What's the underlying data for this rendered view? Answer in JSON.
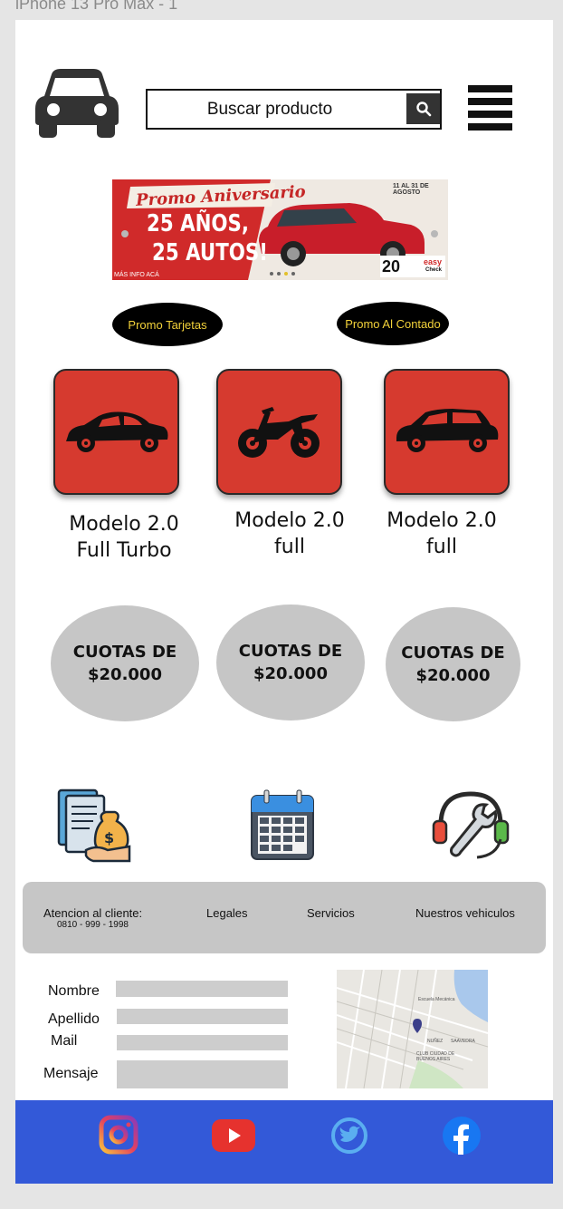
{
  "frame": {
    "title": "iPhone 13 Pro Max - 1"
  },
  "header": {
    "logo_icon": "car-icon",
    "search": {
      "placeholder": "Buscar producto",
      "icon": "search-icon"
    },
    "menu_icon": "hamburger-menu-icon"
  },
  "banner": {
    "headline": "Promo Aniversario",
    "line1": "25 AÑOS,",
    "line2": "25 AUTOS!",
    "dates": "11 AL 31 DE AGOSTO",
    "footer": "MÁS INFO ACÁ",
    "badge": "20",
    "brand": "easy",
    "brand_sub": "Check"
  },
  "promos": [
    {
      "label": "Promo Tarjetas"
    },
    {
      "label": "Promo Al Contado"
    }
  ],
  "products": [
    {
      "icon": "sedan-car-icon",
      "line1": "Modelo 2.0",
      "line2": "Full Turbo"
    },
    {
      "icon": "dirt-bike-icon",
      "line1": "Modelo 2.0",
      "line2": "full"
    },
    {
      "icon": "hatchback-car-icon",
      "line1": "Modelo 2.0",
      "line2": "full"
    }
  ],
  "cuotas": [
    {
      "line1": "CUOTAS DE",
      "line2": "$20.000"
    },
    {
      "line1": "CUOTAS DE",
      "line2": "$20.000"
    },
    {
      "line1": "CUOTAS DE",
      "line2": "$20.000"
    }
  ],
  "features": [
    {
      "icon": "financing-documents-icon"
    },
    {
      "icon": "calendar-icon"
    },
    {
      "icon": "support-wrench-headset-icon"
    }
  ],
  "info_bar": {
    "customer_service": "Atencion al cliente:",
    "phone": "0810 - 999 - 1998",
    "legales": "Legales",
    "servicios": "Servicios",
    "vehiculos": "Nuestros vehiculos"
  },
  "form": {
    "nombre": "Nombre",
    "apellido": "Apellido",
    "mail": "Mail",
    "mensaje": "Mensaje"
  },
  "map": {
    "label1": "Escuela Mecánica",
    "label2": "NUÑEZ",
    "label3": "SAAVEDRA",
    "label4": "CLUB CIUDAD DE BUENOS AIRES"
  },
  "social": [
    {
      "icon": "instagram-icon"
    },
    {
      "icon": "youtube-icon"
    },
    {
      "icon": "twitter-icon"
    },
    {
      "icon": "facebook-icon"
    }
  ],
  "colors": {
    "tile_red": "#d63a2f",
    "social_blue": "#3359d8",
    "promo_text": "#f3d23a",
    "gray": "#c6c6c6"
  }
}
